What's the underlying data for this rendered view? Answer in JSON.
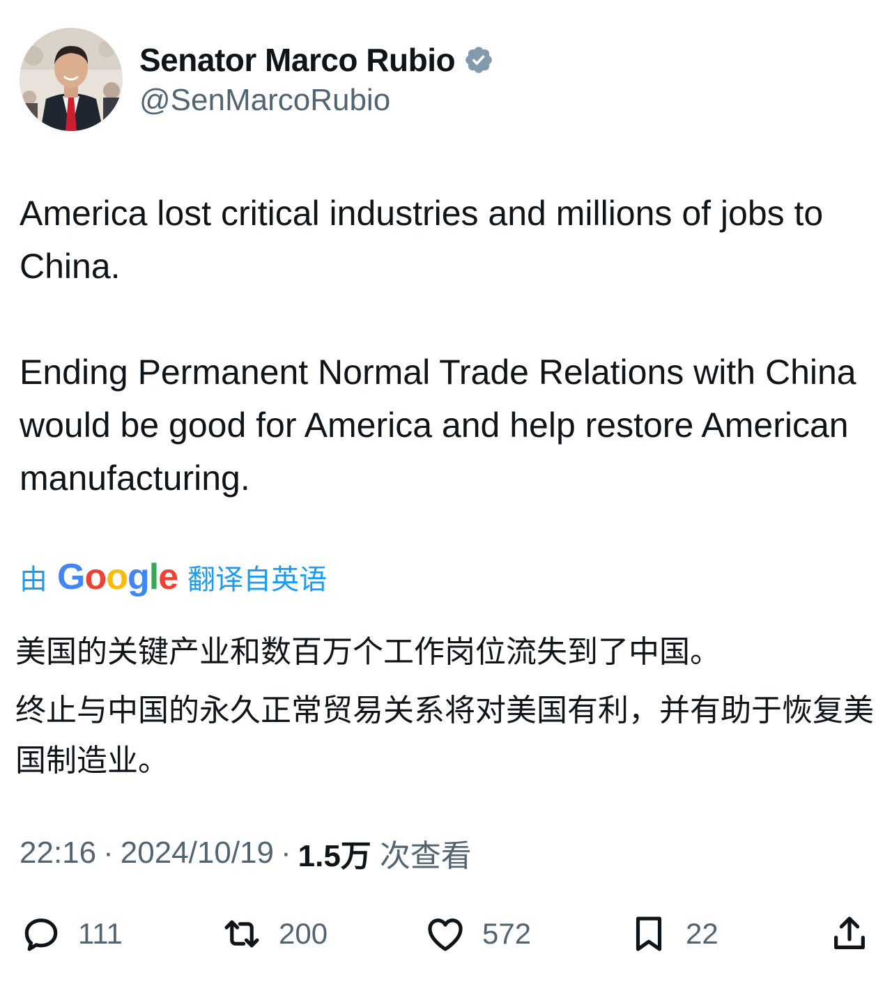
{
  "author": {
    "display_name": "Senator Marco Rubio",
    "handle": "@SenMarcoRubio",
    "verified_icon": "verified-badge-icon",
    "verified_color": "#829aab"
  },
  "tweet": {
    "paragraphs": [
      "America lost critical industries and millions of jobs to China.",
      "Ending Permanent Normal Trade Relations with China would be good for America and help restore American manufacturing."
    ]
  },
  "translation": {
    "prefix": "由",
    "provider": "Google",
    "suffix": "翻译自英语",
    "paragraphs": [
      "美国的关键产业和数百万个工作岗位流失到了中国。",
      "终止与中国的永久正常贸易关系将对美国有利，并有助于恢复美国制造业。"
    ]
  },
  "meta": {
    "time": "22:16",
    "date": "2024/10/19",
    "views_count": "1.5万",
    "views_label": "次查看",
    "separator": "·"
  },
  "actions": {
    "replies": "111",
    "reposts": "200",
    "likes": "572",
    "bookmarks": "22"
  },
  "colors": {
    "link_blue": "#1d9bf0",
    "secondary_text": "#536471",
    "primary_text": "#0f1419"
  }
}
